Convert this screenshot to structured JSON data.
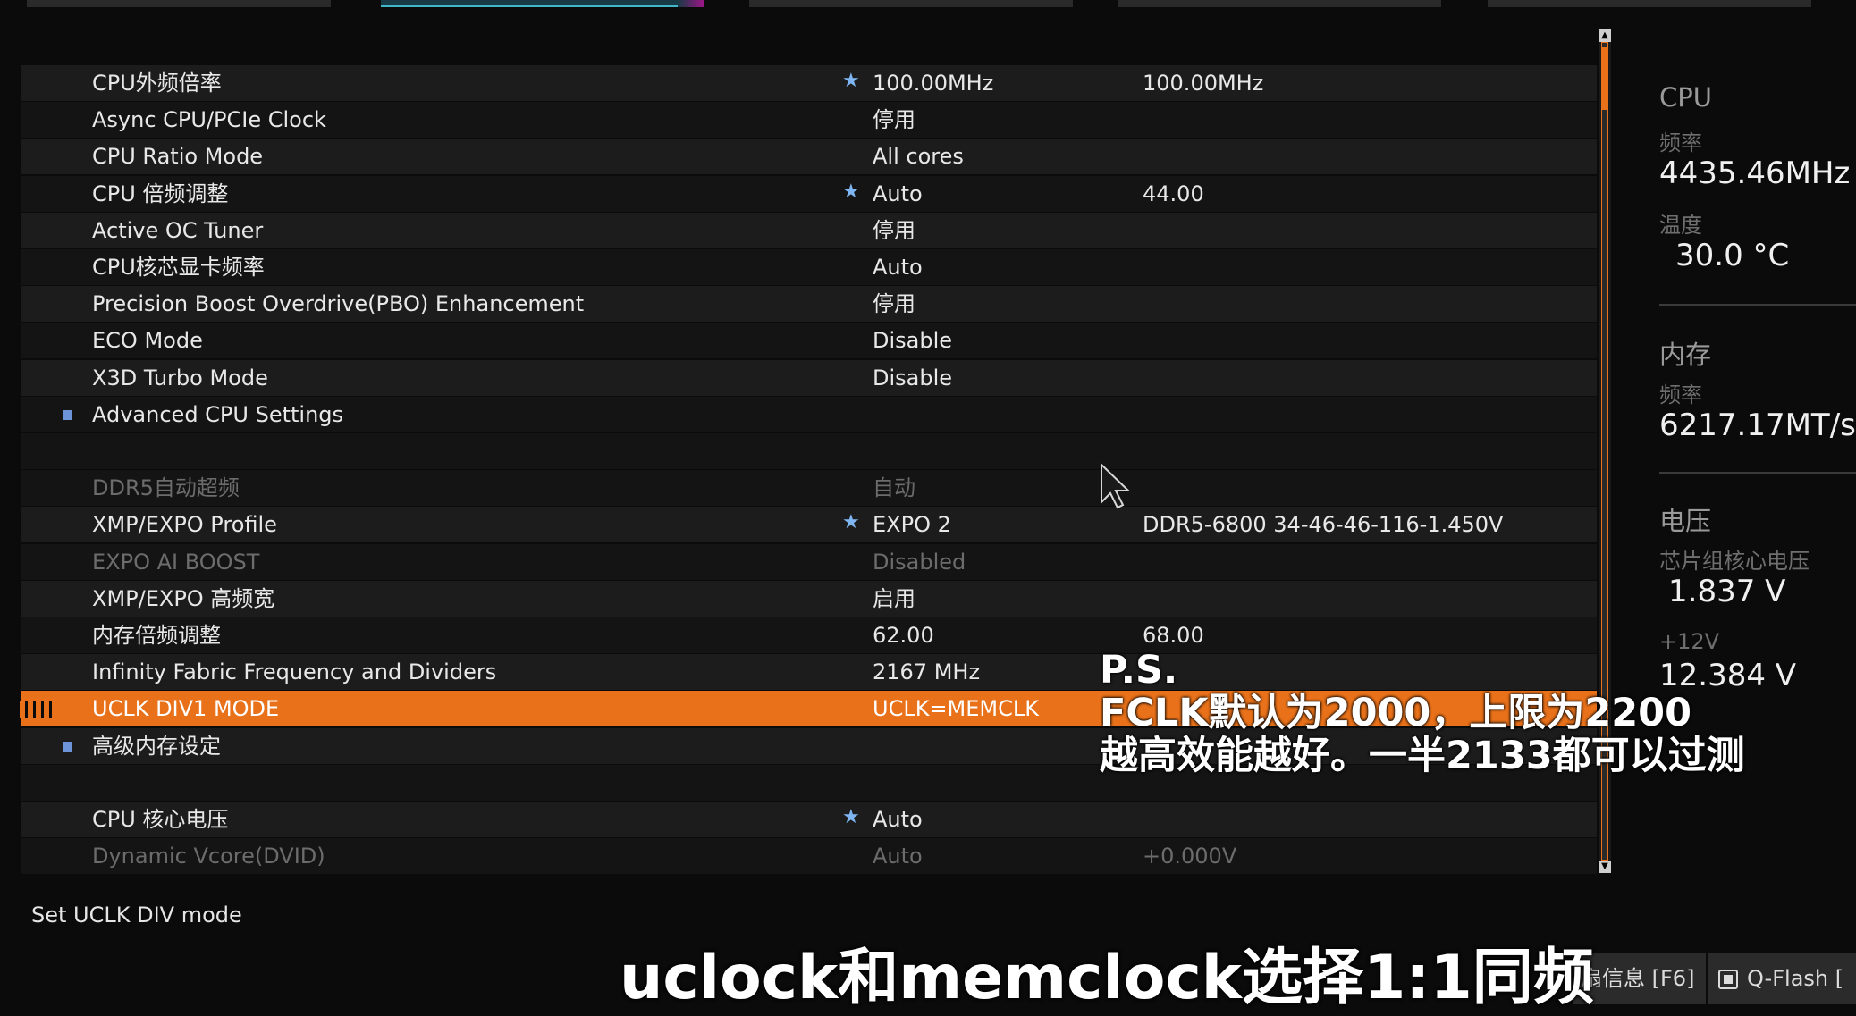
{
  "rows": [
    {
      "label": "CPU外频倍率",
      "star": true,
      "value": "100.00MHz",
      "value2": "100.00MHz"
    },
    {
      "label": "Async CPU/PCIe Clock",
      "value": "停用"
    },
    {
      "label": "CPU Ratio Mode",
      "value": "All cores"
    },
    {
      "label": "CPU 倍频调整",
      "star": true,
      "value": "Auto",
      "value2": "44.00"
    },
    {
      "label": "Active OC Tuner",
      "value": "停用"
    },
    {
      "label": "CPU核芯显卡频率",
      "value": "Auto"
    },
    {
      "label": "Precision Boost Overdrive(PBO) Enhancement",
      "value": "停用"
    },
    {
      "label": "ECO Mode",
      "value": "Disable"
    },
    {
      "label": "X3D Turbo Mode",
      "value": "Disable"
    },
    {
      "label": "Advanced CPU Settings",
      "submenu": true
    },
    {
      "gap": true
    },
    {
      "label": "DDR5自动超频",
      "value": "自动",
      "dim": true
    },
    {
      "label": "XMP/EXPO Profile",
      "star": true,
      "value": "EXPO 2",
      "value2": "DDR5-6800 34-46-46-116-1.450V"
    },
    {
      "label": "EXPO AI BOOST",
      "value": "Disabled",
      "dim": true
    },
    {
      "label": "XMP/EXPO 高频宽",
      "value": "启用"
    },
    {
      "label": "内存倍频调整",
      "value": "62.00",
      "value2": "68.00"
    },
    {
      "label": "Infinity Fabric Frequency and Dividers",
      "value": "2167 MHz"
    },
    {
      "label": "UCLK DIV1 MODE",
      "value": "UCLK=MEMCLK",
      "selected": true
    },
    {
      "label": "高级内存设定",
      "submenu": true
    },
    {
      "gap": true
    },
    {
      "label": "CPU 核心电压",
      "star": true,
      "value": "Auto"
    },
    {
      "label": "Dynamic Vcore(DVID)",
      "value": "Auto",
      "value2": "+0.000V",
      "dim": true
    }
  ],
  "side": {
    "cpu_title": "CPU",
    "cpu_freq_label": "频率",
    "cpu_freq_value": "4435.46MHz",
    "cpu_temp_label": "温度",
    "cpu_temp_value": "30.0 °C",
    "mem_title": "内存",
    "mem_freq_label": "频率",
    "mem_freq_value": "6217.17MT/s",
    "volt_title": "电压",
    "volt_chipset_label": "芯片组核心电压",
    "volt_chipset_value": "1.837 V",
    "volt_12v_label": "+12V",
    "volt_12v_value": "12.384 V"
  },
  "help_text": "Set UCLK DIV mode",
  "overlay_note": {
    "line1": "P.S.",
    "line2": "FCLK默认为2000，上限为2200",
    "line3": "越高效能越好。一半2133都可以过测"
  },
  "subtitle": "uclock和memclock选择1:1同频",
  "footer": {
    "fan_info": "扇信息 [F6]",
    "qflash": "Q-Flash ["
  },
  "colors": {
    "accent": "#e8711a",
    "star": "#7fb6f2",
    "bullet": "#6d93d9"
  }
}
